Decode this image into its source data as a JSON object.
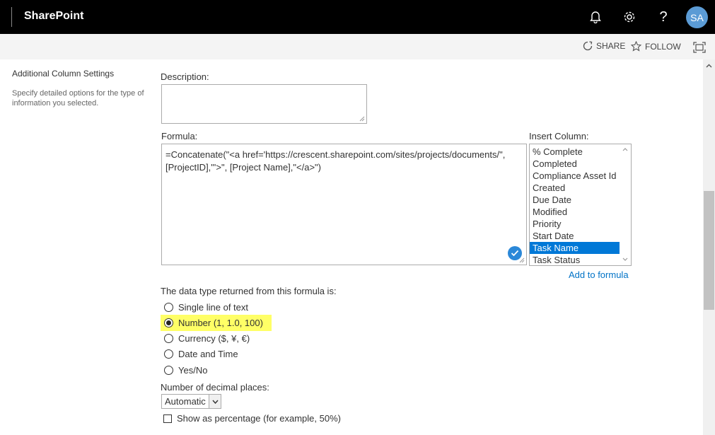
{
  "suite_bar": {
    "app_name": "SharePoint",
    "avatar_initials": "SA"
  },
  "command_bar": {
    "share_label": "SHARE",
    "follow_label": "FOLLOW"
  },
  "settings": {
    "section_title": "Additional Column Settings",
    "section_description": "Specify detailed options for the type of information you selected."
  },
  "description": {
    "label": "Description:",
    "value": ""
  },
  "formula": {
    "label": "Formula:",
    "value": "=Concatenate(\"<a href='https://crescent.sharepoint.com/sites/projects/documents/\",[ProjectID],\"'>\", [Project Name],\"</a>\")"
  },
  "insert_column": {
    "label": "Insert Column:",
    "items": [
      "% Complete",
      "Completed",
      "Compliance Asset Id",
      "Created",
      "Due Date",
      "Modified",
      "Priority",
      "Start Date",
      "Task Name",
      "Task Status"
    ],
    "selected": "Task Name",
    "add_link": "Add to formula"
  },
  "data_type": {
    "label": "The data type returned from this formula is:",
    "options": [
      "Single line of text",
      "Number (1, 1.0, 100)",
      "Currency ($, ¥, €)",
      "Date and Time",
      "Yes/No"
    ],
    "selected": "Number (1, 1.0, 100)"
  },
  "decimal_places": {
    "label": "Number of decimal places:",
    "value": "Automatic"
  },
  "percentage": {
    "label": "Show as percentage (for example, 50%)",
    "checked": false
  },
  "colors": {
    "accent": "#0078d7",
    "highlight": "#ffff66",
    "suite_bar": "#000000"
  }
}
